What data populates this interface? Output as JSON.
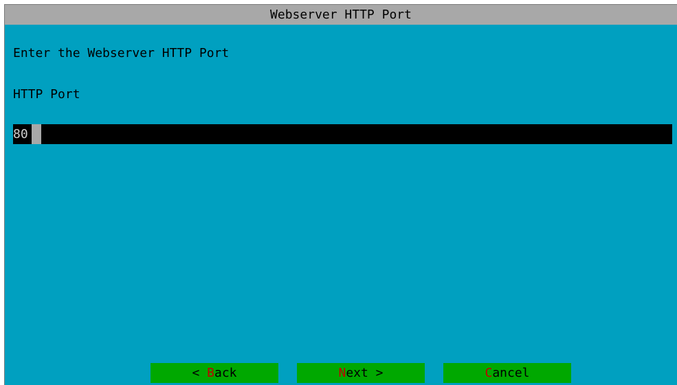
{
  "dialog": {
    "title": "Webserver HTTP Port",
    "prompt": "Enter the Webserver HTTP Port",
    "field_label": "HTTP Port",
    "field_value": "80"
  },
  "buttons": {
    "back": {
      "prefix": "< ",
      "hotkey": "B",
      "rest": "ack"
    },
    "next": {
      "prefix": "",
      "hotkey": "N",
      "rest": "ext >"
    },
    "cancel": {
      "prefix": "",
      "hotkey": "C",
      "rest": "ancel"
    }
  },
  "colors": {
    "background": "#00a0c0",
    "titlebar": "#a8a8a8",
    "input_background": "#000000",
    "button": "#00a800",
    "hotkey": "#c00000"
  }
}
